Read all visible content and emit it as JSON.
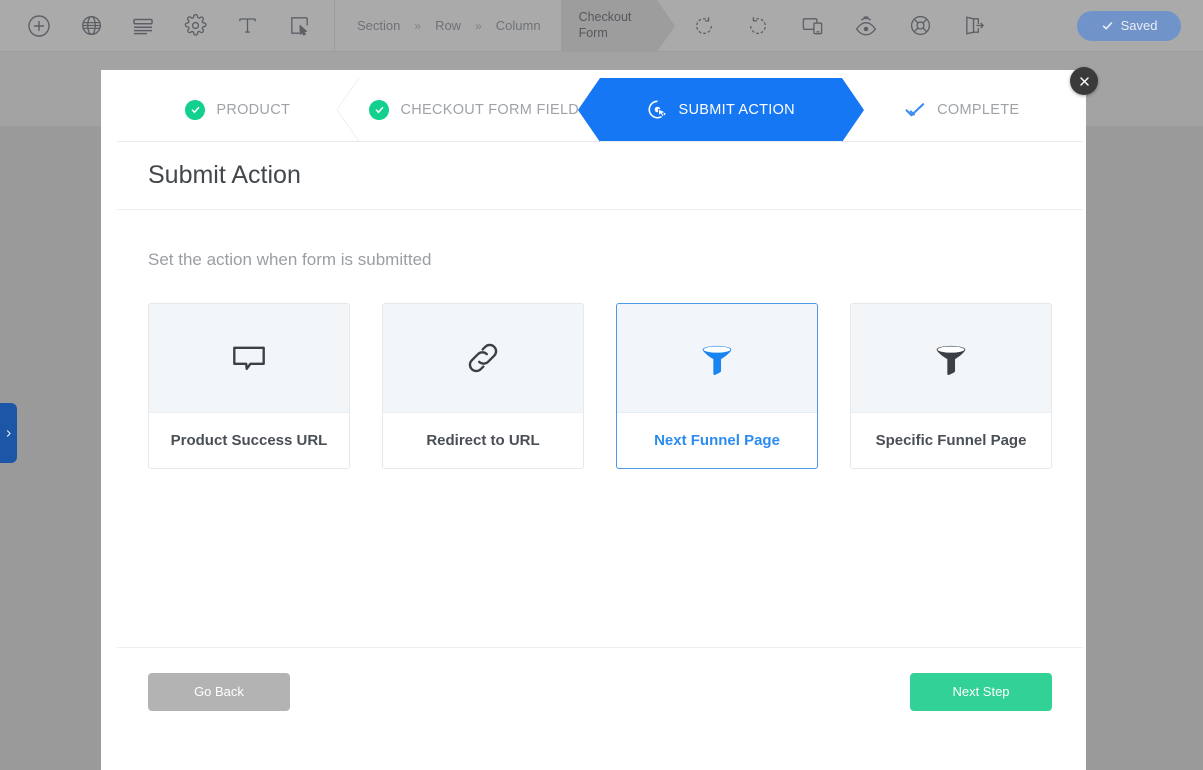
{
  "toolbar": {
    "icons": [
      {
        "name": "add-icon",
        "title": "Add"
      },
      {
        "name": "globe-icon",
        "title": "Global"
      },
      {
        "name": "rows-icon",
        "title": "Sections"
      },
      {
        "name": "gear-icon",
        "title": "Settings"
      },
      {
        "name": "text-icon",
        "title": "Typography"
      },
      {
        "name": "select-region-icon",
        "title": "Select"
      }
    ],
    "right_icons": [
      {
        "name": "undo-icon",
        "title": "Undo"
      },
      {
        "name": "redo-icon",
        "title": "Redo"
      },
      {
        "name": "responsive-icon",
        "title": "Responsive preview"
      },
      {
        "name": "preview-eye-icon",
        "title": "Preview"
      },
      {
        "name": "help-lifebuoy-icon",
        "title": "Help"
      },
      {
        "name": "exit-icon",
        "title": "Exit"
      }
    ],
    "saved_label": "Saved",
    "saved_color": "#7094c9"
  },
  "breadcrumb": {
    "items": [
      "Section",
      "Row",
      "Column"
    ],
    "separator": "»",
    "active": "Checkout Form",
    "active_line1": "Checkout",
    "active_line2": "Form"
  },
  "left_handle": {
    "icon": "chevron-right-icon",
    "color": "#1d56a7"
  },
  "modal": {
    "close_icon": "close-icon",
    "title": "Submit Action",
    "subtitle": "Set the action when form is submitted",
    "steps": [
      {
        "label": "PRODUCT",
        "icon": "check-circle-icon",
        "state": "complete"
      },
      {
        "label": "CHECKOUT FORM FIELDS",
        "icon": "check-circle-icon",
        "state": "complete"
      },
      {
        "label": "SUBMIT ACTION",
        "icon": "click-target-icon",
        "state": "active"
      },
      {
        "label": "COMPLETE",
        "icon": "check-icon",
        "state": "pending"
      }
    ],
    "active_step_color": "#1677f5",
    "complete_step_color": "#12d18e",
    "options": [
      {
        "label": "Product Success URL",
        "icon": "speech-bubble-icon",
        "selected": false
      },
      {
        "label": "Redirect to URL",
        "icon": "link-chain-icon",
        "selected": false
      },
      {
        "label": "Next Funnel Page",
        "icon": "funnel-icon",
        "selected": true
      },
      {
        "label": "Specific Funnel Page",
        "icon": "funnel-icon",
        "selected": false
      }
    ],
    "footer": {
      "back_label": "Go Back",
      "next_label": "Next Step",
      "back_color": "#b3b3b3",
      "next_color": "#32d296"
    }
  }
}
